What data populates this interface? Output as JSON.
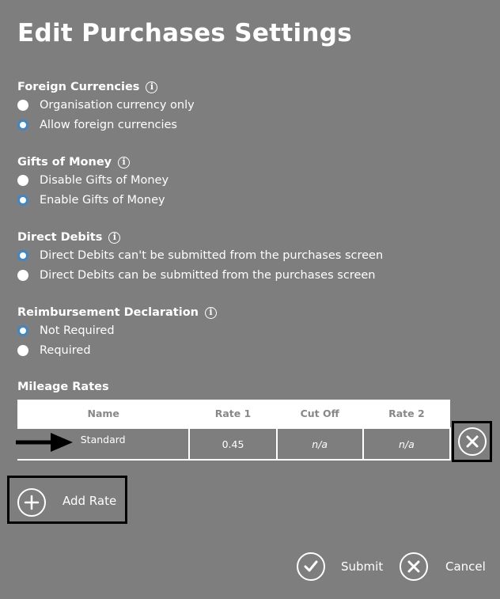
{
  "page_title": "Edit Purchases Settings",
  "sections": [
    {
      "title": "Foreign Currencies",
      "options": [
        {
          "label": "Organisation currency only",
          "selected": false
        },
        {
          "label": "Allow foreign currencies",
          "selected": true
        }
      ]
    },
    {
      "title": "Gifts of Money",
      "options": [
        {
          "label": "Disable Gifts of Money",
          "selected": false
        },
        {
          "label": "Enable Gifts of Money",
          "selected": true
        }
      ]
    },
    {
      "title": "Direct Debits",
      "options": [
        {
          "label": "Direct Debits can't be submitted from the purchases screen",
          "selected": true
        },
        {
          "label": "Direct Debits can be submitted from the purchases screen",
          "selected": false
        }
      ]
    },
    {
      "title": "Reimbursement Declaration",
      "options": [
        {
          "label": "Not Required",
          "selected": true
        },
        {
          "label": "Required",
          "selected": false
        }
      ]
    }
  ],
  "mileage": {
    "title": "Mileage Rates",
    "columns": [
      "Name",
      "Rate 1",
      "Cut Off",
      "Rate 2"
    ],
    "rows": [
      {
        "name": "Standard",
        "rate1": "0.45",
        "cutoff": "n/a",
        "rate2": "n/a"
      }
    ],
    "add_label": "Add Rate"
  },
  "footer": {
    "submit_label": "Submit",
    "cancel_label": "Cancel"
  },
  "colors": {
    "background": "#7e7e7e",
    "radio_selected": "#3f88c8",
    "annotation": "#000000"
  },
  "icons": {
    "info": "info-icon",
    "delete": "close-circle-icon",
    "add": "plus-circle-icon",
    "submit": "check-circle-icon",
    "cancel": "x-circle-icon",
    "pointer": "arrow-right-icon"
  }
}
